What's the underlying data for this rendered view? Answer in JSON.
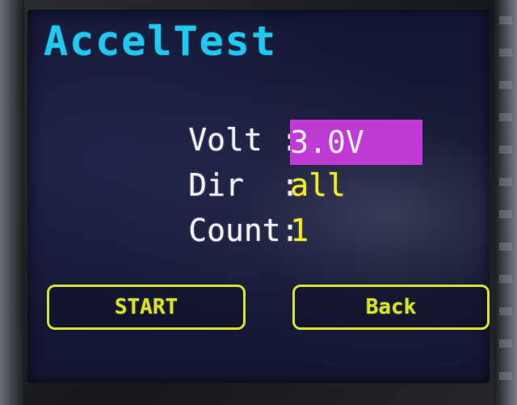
{
  "title": "AccelTest",
  "rows": [
    {
      "label": "Volt :",
      "value": "3.0V"
    },
    {
      "label": "Dir  :",
      "value": "all"
    },
    {
      "label": "Count:",
      "value": "1"
    }
  ],
  "buttons": {
    "start": "START",
    "back": "Back"
  },
  "colors": {
    "title": "#21c8f0",
    "value": "#f4ec2a",
    "selection": "#c03ad6",
    "button": "#d8e22a",
    "screen_bg": "#141733"
  }
}
